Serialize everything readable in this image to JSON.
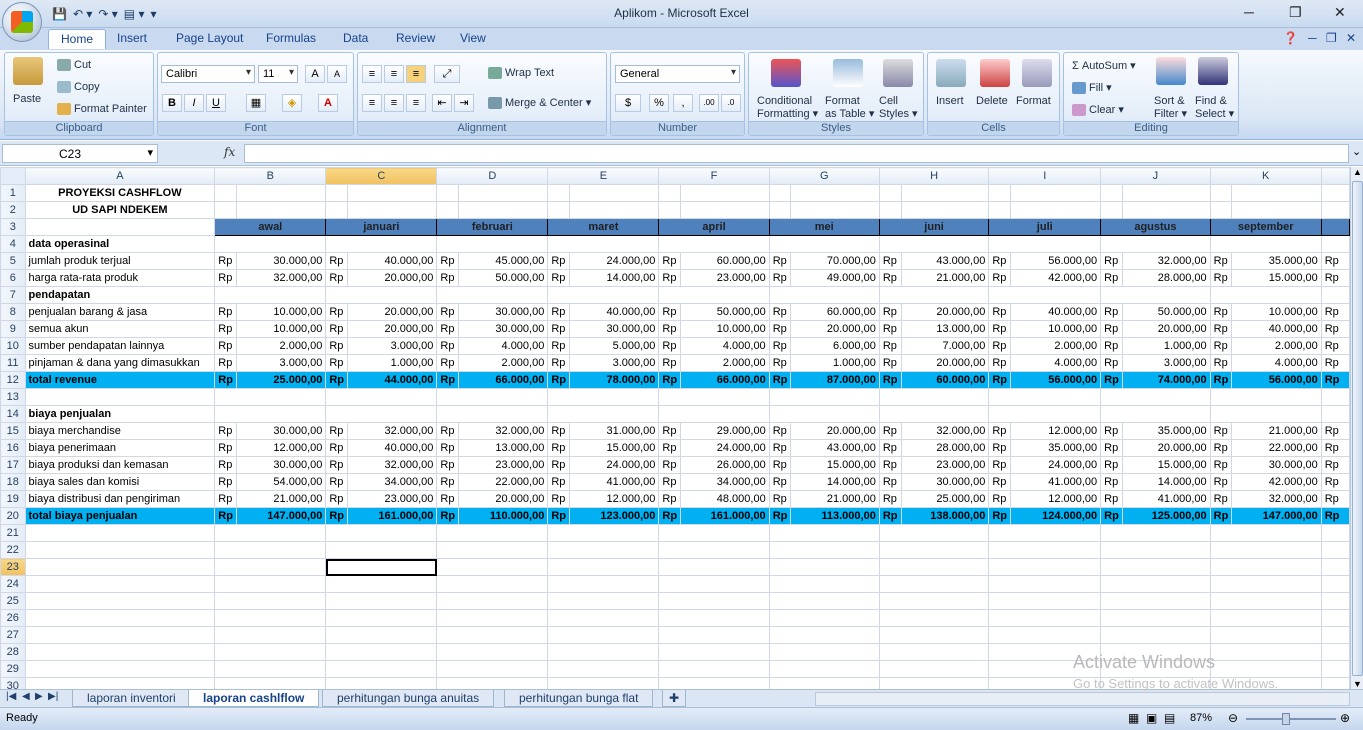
{
  "window": {
    "title": "Aplikom - Microsoft Excel"
  },
  "ribbon_tabs": [
    "Home",
    "Insert",
    "Page Layout",
    "Formulas",
    "Data",
    "Review",
    "View"
  ],
  "clipboard": {
    "paste": "Paste",
    "cut": "Cut",
    "copy": "Copy",
    "format_painter": "Format Painter",
    "label": "Clipboard"
  },
  "font": {
    "name": "Calibri",
    "size": "11",
    "label": "Font"
  },
  "alignment": {
    "wrap_text": "Wrap Text",
    "merge_center": "Merge & Center",
    "label": "Alignment"
  },
  "number": {
    "format": "General",
    "label": "Number"
  },
  "styles": {
    "conditional1": "Conditional",
    "conditional2": "Formatting",
    "table1": "Format",
    "table2": "as Table",
    "cell1": "Cell",
    "cell2": "Styles",
    "label": "Styles"
  },
  "cells": {
    "insert": "Insert",
    "delete": "Delete",
    "format": "Format",
    "label": "Cells"
  },
  "editing": {
    "autosum": "AutoSum",
    "fill": "Fill",
    "clear": "Clear",
    "sort1": "Sort &",
    "sort2": "Filter",
    "find1": "Find &",
    "find2": "Select",
    "label": "Editing"
  },
  "formula_bar": {
    "name_box": "C23",
    "fx": "fx",
    "value": ""
  },
  "sheet": {
    "columns": [
      "A",
      "B",
      "C",
      "D",
      "E",
      "F",
      "G",
      "H",
      "I",
      "J",
      "K"
    ],
    "cur": "Rp",
    "header_labels": [
      "awal",
      "januari",
      "februari",
      "maret",
      "april",
      "mei",
      "juni",
      "juli",
      "agustus",
      "september"
    ],
    "title1": "PROYEKSI CASHFLOW",
    "title2": "UD SAPI NDEKEM",
    "section_ops": "data operasinal",
    "section_income": "pendapatan",
    "section_cost": "biaya penjualan",
    "rows": {
      "r5": {
        "label": "jumlah produk terjual",
        "v": [
          "30.000,00",
          "40.000,00",
          "45.000,00",
          "24.000,00",
          "60.000,00",
          "70.000,00",
          "43.000,00",
          "56.000,00",
          "32.000,00",
          "35.000,00"
        ]
      },
      "r6": {
        "label": "harga rata-rata produk",
        "v": [
          "32.000,00",
          "20.000,00",
          "50.000,00",
          "14.000,00",
          "23.000,00",
          "49.000,00",
          "21.000,00",
          "42.000,00",
          "28.000,00",
          "15.000,00"
        ]
      },
      "r8": {
        "label": "penjualan barang & jasa",
        "v": [
          "10.000,00",
          "20.000,00",
          "30.000,00",
          "40.000,00",
          "50.000,00",
          "60.000,00",
          "20.000,00",
          "40.000,00",
          "50.000,00",
          "10.000,00"
        ]
      },
      "r9": {
        "label": "semua akun",
        "v": [
          "10.000,00",
          "20.000,00",
          "30.000,00",
          "30.000,00",
          "10.000,00",
          "20.000,00",
          "13.000,00",
          "10.000,00",
          "20.000,00",
          "40.000,00"
        ]
      },
      "r10": {
        "label": "sumber pendapatan lainnya",
        "v": [
          "2.000,00",
          "3.000,00",
          "4.000,00",
          "5.000,00",
          "4.000,00",
          "6.000,00",
          "7.000,00",
          "2.000,00",
          "1.000,00",
          "2.000,00"
        ]
      },
      "r11": {
        "label": "pinjaman & dana yang dimasukkan",
        "v": [
          "3.000,00",
          "1.000,00",
          "2.000,00",
          "3.000,00",
          "2.000,00",
          "1.000,00",
          "20.000,00",
          "4.000,00",
          "3.000,00",
          "4.000,00"
        ]
      },
      "r12": {
        "label": "total revenue",
        "v": [
          "25.000,00",
          "44.000,00",
          "66.000,00",
          "78.000,00",
          "66.000,00",
          "87.000,00",
          "60.000,00",
          "56.000,00",
          "74.000,00",
          "56.000,00"
        ]
      },
      "r15": {
        "label": "biaya merchandise",
        "v": [
          "30.000,00",
          "32.000,00",
          "32.000,00",
          "31.000,00",
          "29.000,00",
          "20.000,00",
          "32.000,00",
          "12.000,00",
          "35.000,00",
          "21.000,00"
        ]
      },
      "r16": {
        "label": "biaya penerimaan",
        "v": [
          "12.000,00",
          "40.000,00",
          "13.000,00",
          "15.000,00",
          "24.000,00",
          "43.000,00",
          "28.000,00",
          "35.000,00",
          "20.000,00",
          "22.000,00"
        ]
      },
      "r17": {
        "label": "biaya produksi dan kemasan",
        "v": [
          "30.000,00",
          "32.000,00",
          "23.000,00",
          "24.000,00",
          "26.000,00",
          "15.000,00",
          "23.000,00",
          "24.000,00",
          "15.000,00",
          "30.000,00"
        ]
      },
      "r18": {
        "label": "biaya sales dan komisi",
        "v": [
          "54.000,00",
          "34.000,00",
          "22.000,00",
          "41.000,00",
          "34.000,00",
          "14.000,00",
          "30.000,00",
          "41.000,00",
          "14.000,00",
          "42.000,00"
        ]
      },
      "r19": {
        "label": "biaya distribusi dan pengiriman",
        "v": [
          "21.000,00",
          "23.000,00",
          "20.000,00",
          "12.000,00",
          "48.000,00",
          "21.000,00",
          "25.000,00",
          "12.000,00",
          "41.000,00",
          "32.000,00"
        ]
      },
      "r20": {
        "label": "total biaya penjualan",
        "v": [
          "147.000,00",
          "161.000,00",
          "110.000,00",
          "123.000,00",
          "161.000,00",
          "113.000,00",
          "138.000,00",
          "124.000,00",
          "125.000,00",
          "147.000,00"
        ]
      }
    }
  },
  "sheet_tabs": [
    "laporan inventori",
    "laporan cashlflow",
    "perhitungan bunga anuitas",
    "perhitungan bunga flat"
  ],
  "status": {
    "ready": "Ready",
    "zoom": "87%"
  },
  "watermark": {
    "line1": "Activate Windows",
    "line2": "Go to Settings to activate Windows."
  },
  "colors": {
    "header_fill": "#4f81bd",
    "total_fill": "#00b0f0",
    "selected_header": "#f1c15f"
  }
}
